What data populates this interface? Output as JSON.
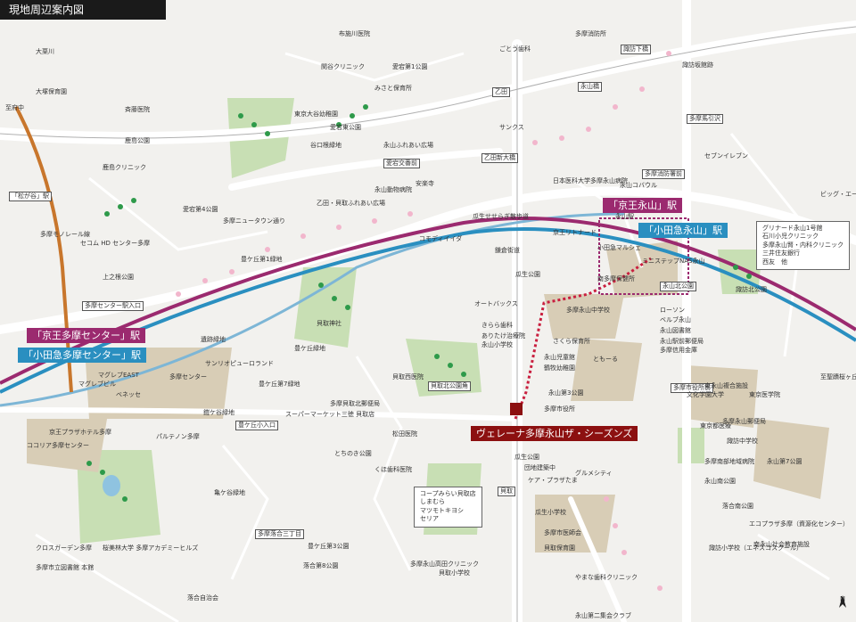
{
  "title": "現地周辺案内図",
  "property_name": "ヴェレーナ多摩永山ザ・シーズンズ",
  "stations": {
    "keio_nagayama": "「京王永山」駅",
    "odakyu_nagayama": "「小田急永山」駅",
    "keio_tamacenter": "「京王多摩センター」駅",
    "odakyu_tamacenter": "「小田急多摩センター」駅",
    "matsugaya": "「松が谷」駅"
  },
  "road_labels": {
    "suwashimohashi": "諏訪下橋",
    "nagayamabashi": "永山橋",
    "otsuta": "乙田",
    "otsuta_shin_ohashi": "乙田新大橋",
    "tamauma_sawa": "多摩馬引沢",
    "tama_shobosho_mae": "多摩消防署前",
    "aitani_kosaten": "愛宕交番前",
    "tamacenter_eki_iriguchi": "多摩センター駅入口",
    "toyogaoka_shogakko_iriguchi": "豊ケ丘小入口",
    "tama_shiyakusho_mae": "多摩市役所前",
    "nagayama_kitakoen_mae": "永山北公園",
    "kaitori_kita_koen_kado": "貝取北公園角",
    "kaitori": "貝取",
    "tamaochiai_sanchome": "多摩落合三丁目",
    "nagayama_koen": "永山公園"
  },
  "place_labels": [
    "大栗川",
    "大塚保育園",
    "斉藤医院",
    "鹿島公園",
    "鹿島クリニック",
    "セコム HD センター多摩",
    "上之根公園",
    "布施川医院",
    "関谷クリニック",
    "愛宕第1公園",
    "みさと保育所",
    "東京大谷幼稚園",
    "愛宕東公園",
    "谷口根緑地",
    "愛宕第4公園",
    "多摩ニュータウン通り",
    "豊ケ丘第1緑地",
    "乙田・貝取ふれあい広場",
    "永山動物病院",
    "安楽寺",
    "サンクス",
    "ごとう歯科",
    "多摩消防所",
    "永山ふれあい広場",
    "日本医科大学多摩永山病院",
    "永山コバウル",
    "諏訪坂館跡",
    "永山駅",
    "セブンイレブン",
    "ビッグ・エー",
    "瓜生せせらぎ散歩道",
    "コモディイイダ",
    "鎌倉街道",
    "瓜生公園",
    "京王リトナード",
    "小田急マルシェ",
    "南多摩保健所",
    "ミニステップNAS永山",
    "諏訪北公園",
    "ローソン",
    "ベルブ永山",
    "永山図書館",
    "永山駅前郵便局",
    "多摩信用金庫",
    "貝取神社",
    "遺跡緑地",
    "豊ケ丘緑地",
    "サンリオピューロランド",
    "豊ケ丘第7緑地",
    "貝取西医院",
    "多摩貝取北郵便局",
    "スーパーマーケット三徳 貝取店",
    "松田医院",
    "とちのき公園",
    "くほ歯科医院",
    "鎧ケ谷緑地",
    "亀ケ谷緑地",
    "豊ケ丘第3公園",
    "落合第8公園",
    "落合自治会",
    "コープみらい貝取店 しまむら マツモトキヨシ セリア",
    "多摩永山高田クリニック",
    "貝取小学校",
    "瓜生小学校",
    "瓜生公園",
    "団地建築中",
    "ケア・プラザたま",
    "オートバックス",
    "きらら歯科",
    "ありたけ治療院",
    "永山小学校",
    "多摩永山中学校",
    "ともーる",
    "永山児童館",
    "鶴牧幼稚園",
    "永山第3公園",
    "多摩市役所",
    "東永山複合施設",
    "文化学園大学",
    "東京医学院",
    "多摩永山郵便局",
    "諏訪中学校",
    "永山第7公園",
    "諏訪小学校（エネスコスクール）",
    "エコプラザ多摩（資源化センター）",
    "南永山社会教育施設",
    "永山第二集会クラブ",
    "やまな歯科クリニック",
    "グルメシティ",
    "多摩市医師会",
    "貝取保育園",
    "さくら保育所",
    "多摩センター",
    "ベネッセ",
    "パルテノン多摩",
    "京王プラザホテル多摩",
    "ココリア多摩センター",
    "多摩市立図書館 本館",
    "クロスガーデン多摩",
    "桜美林大学 多摩アカデミーヒルズ",
    "マグレブEAST",
    "マグレブビル",
    "落合南公園",
    "多摩南部地域病院",
    "永山南公園",
    "東京都医療",
    "多摩モノレール線",
    "至府中",
    "至聖蹟桜ヶ丘"
  ],
  "info_boxes": {
    "grinade": [
      "グリナード永山1号館",
      "石川小児クリニック",
      "多摩永山腎・内科クリニック",
      "三井住友銀行",
      "西友　他"
    ],
    "coop": [
      "コープみらい貝取店",
      "しまむら",
      "マツモトキヨシ",
      "セリア"
    ]
  },
  "compass": "N"
}
